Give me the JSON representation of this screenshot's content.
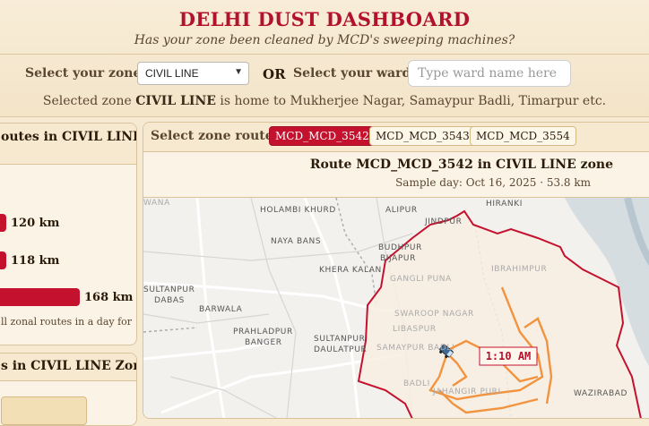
{
  "header": {
    "title": "DELHI DUST DASHBOARD",
    "subtitle": "Has your zone been cleaned by MCD's sweeping machines?"
  },
  "controls": {
    "zone_label": "Select your zone:",
    "zone_value": "CIVIL LINE",
    "or_label": "OR",
    "ward_label": "Select your ward:",
    "ward_placeholder": "Type ward name here"
  },
  "info": {
    "prefix": "Selected zone",
    "zone": "CIVIL LINE",
    "suffix": "is home to Mukherjee Nagar, Samaypur Badli, Timarpur etc."
  },
  "left_panel": {
    "title": "outes in CIVIL LINE",
    "bars": [
      {
        "label": "120 km",
        "km": 120
      },
      {
        "label": "118 km",
        "km": 118
      },
      {
        "label": "168 km",
        "km": 168
      }
    ],
    "note": "ll zonal routes in a day for"
  },
  "left_panel2": {
    "title": "s in CIVIL LINE Zone"
  },
  "route_panel": {
    "label": "Select zone route:",
    "routes": [
      "MCD_MCD_3542",
      "MCD_MCD_3543",
      "MCD_MCD_3554"
    ],
    "active_index": 0,
    "title": "Route MCD_MCD_3542 in CIVIL LINE zone",
    "subtitle": "Sample day: Oct 16, 2025 · 53.8 km",
    "time_label": "1:10 AM"
  },
  "map": {
    "places": [
      "HOLAMBI KHURD",
      "ALIPUR",
      "HIRANKI",
      "JINDPUR",
      "WANA",
      "NAYA BANS",
      "BUDHPUR",
      "BIJAPUR",
      "KHERA KALAN",
      "GANGLI PUNA",
      "IBRAHIMPUR",
      "SULTANPUR",
      "DABAS",
      "BARWALA",
      "SWAROOP NAGAR",
      "LIBASPUR",
      "PRAHLADPUR",
      "BANGER",
      "SULTANPUR",
      "DAULATPUR",
      "SAMAYPUR BADLI",
      "BADLI",
      "JAHANGIR PURI",
      "WAZIRABAD"
    ],
    "colors": {
      "boundary": "#c4122e",
      "route": "#f28a2e"
    }
  }
}
